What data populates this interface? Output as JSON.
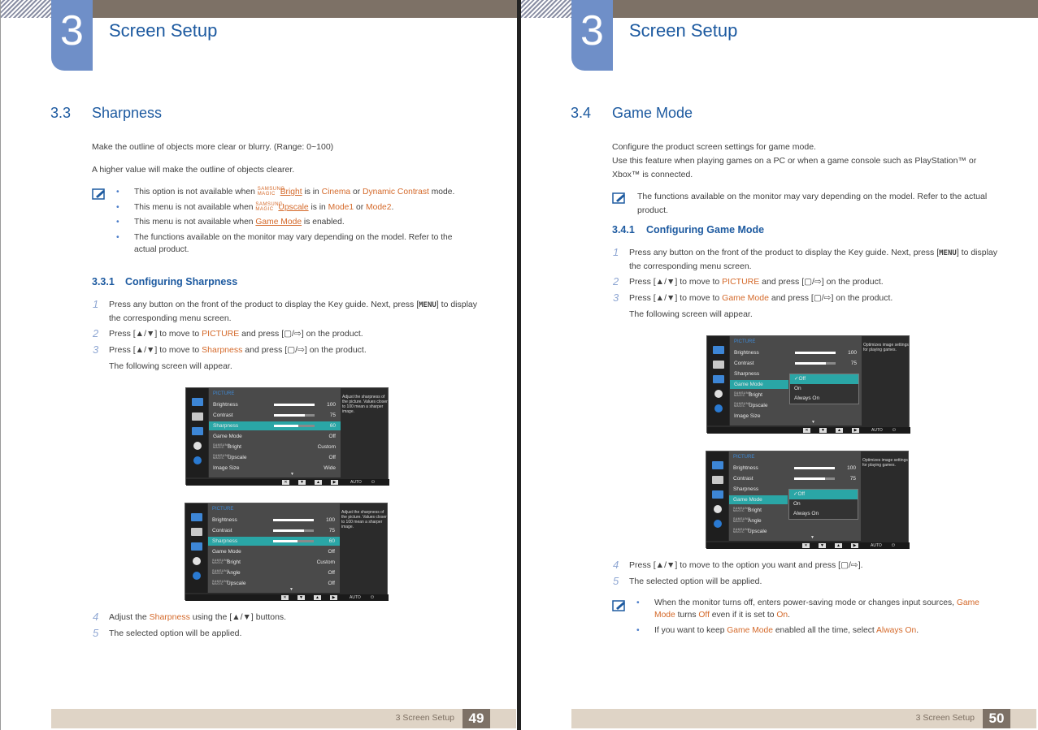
{
  "chapter": {
    "number": "3",
    "title": "Screen Setup"
  },
  "left": {
    "section_number": "3.3",
    "section_title": "Sharpness",
    "intro1": "Make the outline of objects more clear or blurry. (Range: 0~100)",
    "intro2": "A higher value will make the outline of objects clearer.",
    "notes": [
      {
        "pre": "This option is not available when ",
        "magic": "SAMSUNG MAGIC",
        "link": "Bright",
        "mid": " is in ",
        "h1": "Cinema",
        "mid2": " or ",
        "h2": "Dynamic Contrast",
        "post": " mode."
      },
      {
        "pre": "This menu is not available when ",
        "magic": "SAMSUNG MAGIC",
        "link": "Upscale",
        "mid": " is in ",
        "h1": "Mode1",
        "mid2": " or ",
        "h2": "Mode2",
        "post": "."
      },
      {
        "pre": "This menu is not available when ",
        "link": "Game Mode",
        "post": " is enabled."
      },
      {
        "text": "The functions available on the monitor may vary depending on the model. Refer to the actual product."
      }
    ],
    "subsection_number": "3.3.1",
    "subsection_title": "Configuring Sharpness",
    "steps": [
      {
        "n": "1",
        "a": "Press any button on the front of the product to display the Key guide. Next, press [",
        "key": "MENU",
        "b": "] to display the corresponding menu screen."
      },
      {
        "n": "2",
        "a": "Press [▲/▼] to move to ",
        "h": "PICTURE",
        "b": " and press [",
        "c": "] on the product."
      },
      {
        "n": "3",
        "a": "Press [▲/▼] to move to ",
        "h": "Sharpness",
        "b": " and press [",
        "c": "] on the product."
      }
    ],
    "screen_note": "The following screen will appear.",
    "steps_after": [
      {
        "n": "4",
        "a": "Adjust the ",
        "h": "Sharpness",
        "b": " using the [▲/▼] buttons."
      },
      {
        "n": "5",
        "a": "The selected option will be applied."
      }
    ],
    "osd1": {
      "category": "PICTURE",
      "info": "Adjust the sharpness of the picture. Values closer to 100 mean a sharper image.",
      "rows": [
        {
          "label": "Brightness",
          "value": "100",
          "bar": 1.0
        },
        {
          "label": "Contrast",
          "value": "75",
          "bar": 0.75
        },
        {
          "label": "Sharpness",
          "value": "60",
          "bar": 0.6,
          "selected": true
        },
        {
          "label": "Game Mode",
          "value": "Off"
        },
        {
          "label": "Bright",
          "value": "Custom",
          "magic": true
        },
        {
          "label": "Upscale",
          "value": "Off",
          "magic": true
        },
        {
          "label": "Image Size",
          "value": "Wide"
        }
      ]
    },
    "osd2": {
      "category": "PICTURE",
      "info": "Adjust the sharpness of the picture. Values closer to 100 mean a sharper image.",
      "rows": [
        {
          "label": "Brightness",
          "value": "100",
          "bar": 1.0
        },
        {
          "label": "Contrast",
          "value": "75",
          "bar": 0.75
        },
        {
          "label": "Sharpness",
          "value": "60",
          "bar": 0.6,
          "selected": true
        },
        {
          "label": "Game Mode",
          "value": "Off"
        },
        {
          "label": "Bright",
          "value": "Custom",
          "magic": true
        },
        {
          "label": "Angle",
          "value": "Off",
          "magic": true
        },
        {
          "label": "Upscale",
          "value": "Off",
          "magic": true
        }
      ]
    },
    "footer_text": "3 Screen Setup",
    "page_number": "49"
  },
  "right": {
    "section_number": "3.4",
    "section_title": "Game Mode",
    "intro1": "Configure the product screen settings for game mode.",
    "intro2": "Use this feature when playing games on a PC or when a game console such as PlayStation™ or Xbox™ is connected.",
    "note": "The functions available on the monitor may vary depending on the model. Refer to the actual product.",
    "subsection_number": "3.4.1",
    "subsection_title": "Configuring Game Mode",
    "steps": [
      {
        "n": "1",
        "a": "Press any button on the front of the product to display the Key guide. Next, press [",
        "key": "MENU",
        "b": "] to display the corresponding menu screen."
      },
      {
        "n": "2",
        "a": "Press [▲/▼] to move to ",
        "h": "PICTURE",
        "b": " and press [",
        "c": "] on the product."
      },
      {
        "n": "3",
        "a": "Press [▲/▼] to move to ",
        "h": "Game Mode",
        "b": " and press [",
        "c": "] on the product."
      }
    ],
    "screen_note": "The following screen will appear.",
    "steps_after": [
      {
        "n": "4",
        "a": "Press [▲/▼] to move to the option you want and press [",
        "b": "]."
      },
      {
        "n": "5",
        "a": "The selected option will be applied."
      }
    ],
    "bullet1": {
      "a": "When the monitor turns off, enters power-saving mode or changes input sources, ",
      "h1": "Game Mode",
      "b": " turns ",
      "h2": "Off",
      "c": " even if it is set to ",
      "h3": "On",
      "d": "."
    },
    "bullet2": {
      "a": "If you want to keep ",
      "h1": "Game Mode",
      "b": " enabled all the time, select ",
      "h2": "Always On",
      "c": "."
    },
    "osd1": {
      "category": "PICTURE",
      "info": "Optimizes image settings for playing games.",
      "rows": [
        {
          "label": "Brightness",
          "value": "100",
          "bar": 1.0
        },
        {
          "label": "Contrast",
          "value": "75",
          "bar": 0.75
        },
        {
          "label": "Sharpness"
        },
        {
          "label": "Game Mode",
          "selected": true
        },
        {
          "label": "Bright",
          "magic": true
        },
        {
          "label": "Upscale",
          "magic": true
        },
        {
          "label": "Image Size"
        }
      ],
      "options": [
        "Off",
        "On",
        "Always On"
      ]
    },
    "osd2": {
      "category": "PICTURE",
      "info": "Optimizes image settings for playing games.",
      "rows": [
        {
          "label": "Brightness",
          "value": "100",
          "bar": 1.0
        },
        {
          "label": "Contrast",
          "value": "75",
          "bar": 0.75
        },
        {
          "label": "Sharpness"
        },
        {
          "label": "Game Mode",
          "selected": true
        },
        {
          "label": "Bright",
          "magic": true
        },
        {
          "label": "Angle",
          "magic": true
        },
        {
          "label": "Upscale",
          "magic": true
        }
      ],
      "options": [
        "Off",
        "On",
        "Always On"
      ]
    },
    "footer_text": "3 Screen Setup",
    "page_number": "50"
  },
  "osd_common": {
    "magic_prefix": "SAMSUNG MAGIC",
    "auto_label": "AUTO",
    "check": "✓"
  },
  "colors": {
    "accent_blue": "#1d5aa0",
    "highlight_orange": "#d4692a",
    "osd_select": "#2aa6a6",
    "tab_blue": "#6f8fc8"
  }
}
